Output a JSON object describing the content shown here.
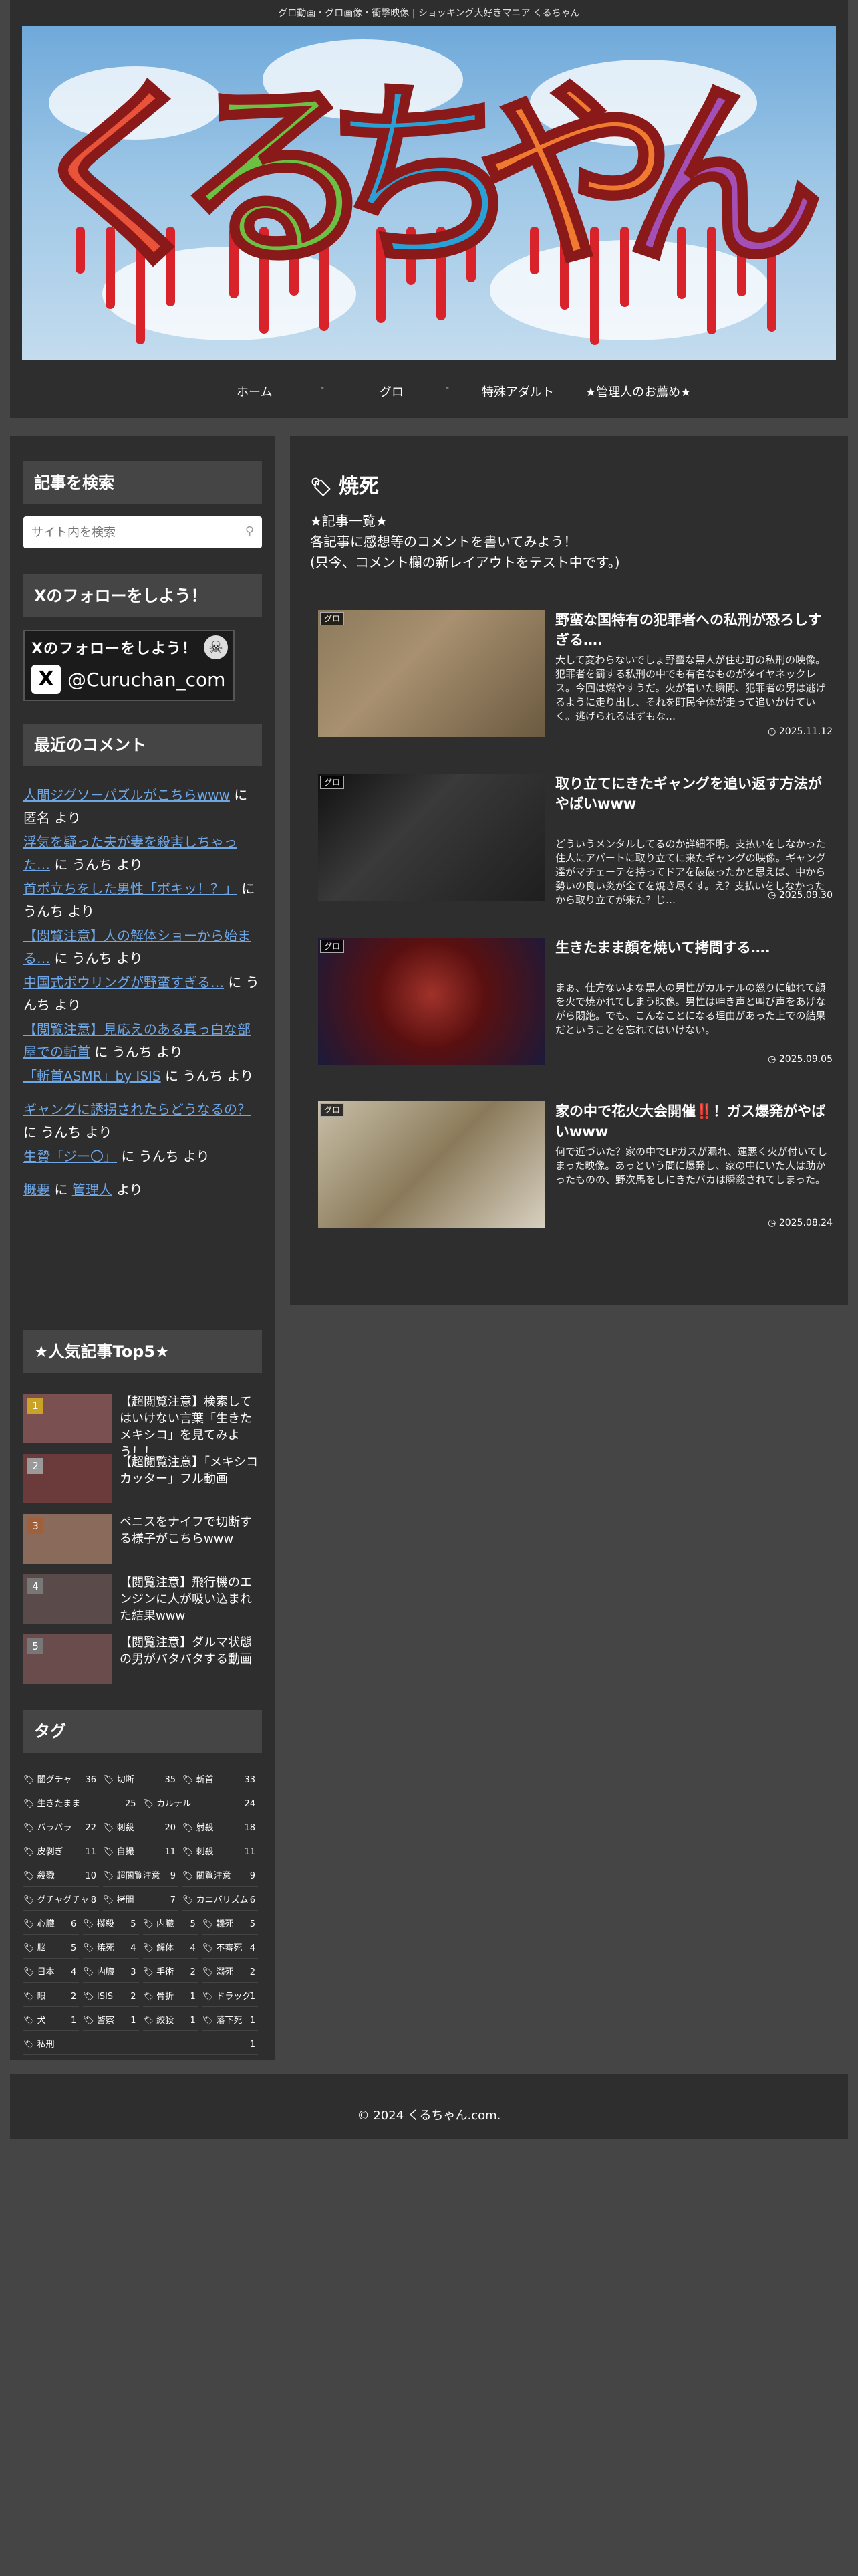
{
  "header": {
    "tagline": "グロ動画・グロ画像・衝撃映像 | ショッキング大好きマニア くるちゃん",
    "banner_chars": [
      "く",
      "る",
      "ち",
      "や",
      "ん"
    ],
    "banner_colors": [
      "#e8533a",
      "#6cc043",
      "#2aa1d6",
      "#f07a2f",
      "#a34fb5"
    ],
    "nav": [
      {
        "label": "ホーム"
      },
      {
        "label": "グロ"
      },
      {
        "label": "特殊アダルト"
      },
      {
        "label": "★管理人のお薦め★"
      }
    ],
    "nav_separator": "-"
  },
  "sidebar": {
    "search": {
      "title": "記事を検索",
      "placeholder": "サイト内を検索"
    },
    "follow": {
      "title": "Xのフォローをしよう！",
      "banner_line1": "Xのフォローをしよう！",
      "handle": "@Curuchan_com"
    },
    "comments": {
      "title": "最近のコメント",
      "items": [
        {
          "link": "人間ジグソーパズルがこちらwww",
          "by": " に 匿名 より"
        },
        {
          "link": "浮気を疑った夫が妻を殺害しちゃった…",
          "by": " に うんち より"
        },
        {
          "link": "首ポ立ちをした男性「ボキッ！？」",
          "by": " に うんち より"
        },
        {
          "link": "【閲覧注意】人の解体ショーから始まる…",
          "by": " に うんち より"
        },
        {
          "link": "中国式ボウリングが野蛮すぎる…",
          "by": " に うんち より"
        },
        {
          "link": "【閲覧注意】見応えのある真っ白な部屋での斬首",
          "by": " に うんち より"
        },
        {
          "link": "「斬首ASMR」by ISIS",
          "by": " に うんち より"
        },
        {
          "link": "ギャングに誘拐されたらどうなるの？",
          "by": " に うんち より"
        },
        {
          "link": "生贄「ジー〇」",
          "by": " に うんち より"
        },
        {
          "link": "概要",
          "by_pre": " に ",
          "by_link": "管理人",
          "by_post": " より"
        }
      ]
    },
    "ranking": {
      "title": "★人気記事Top5★",
      "items": [
        {
          "rank": "1",
          "title": "【超閲覧注意】検索してはいけない言葉「生きたメキシコ」を見てみよう！！",
          "color": "#c9a227"
        },
        {
          "rank": "2",
          "title": "【超閲覧注意】「メキシコカッター」フル動画",
          "color": "#9a9a9a"
        },
        {
          "rank": "3",
          "title": "ペニスをナイフで切断する様子がこちらwww",
          "color": "#a0603a"
        },
        {
          "rank": "4",
          "title": "【閲覧注意】飛行機のエンジンに人が吸い込まれた結果www",
          "color": "#777777"
        },
        {
          "rank": "5",
          "title": "【閲覧注意】ダルマ状態の男がバタバタする動画",
          "color": "#777777"
        }
      ]
    },
    "tags": {
      "title": "タグ",
      "items": [
        [
          "闇グチャ",
          "36"
        ],
        [
          "切断",
          "35"
        ],
        [
          "斬首",
          "33"
        ],
        [
          "生きたまま",
          "25"
        ],
        [
          "カルテル",
          "24"
        ],
        [
          "バラバラ",
          "22"
        ],
        [
          "刺殺",
          "20"
        ],
        [
          "射殺",
          "18"
        ],
        [
          "皮剥ぎ",
          "11"
        ],
        [
          "自撮",
          "11"
        ],
        [
          "刺殺",
          "11"
        ],
        [
          "殺戮",
          "10"
        ],
        [
          "超閲覧注意",
          "9"
        ],
        [
          "閲覧注意",
          "9"
        ],
        [
          "グチャグチャ",
          "8"
        ],
        [
          "拷問",
          "7"
        ],
        [
          "カニバリズム",
          "6"
        ],
        [
          "心臓",
          "6"
        ],
        [
          "撲殺",
          "5"
        ],
        [
          "内臓",
          "5"
        ],
        [
          "轢死",
          "5"
        ],
        [
          "脳",
          "5"
        ],
        [
          "焼死",
          "4"
        ],
        [
          "解体",
          "4"
        ],
        [
          "不審死",
          "4"
        ],
        [
          "日本",
          "4"
        ],
        [
          "内臓",
          "3"
        ],
        [
          "手術",
          "2"
        ],
        [
          "溺死",
          "2"
        ],
        [
          "眼",
          "2"
        ],
        [
          "ISIS",
          "2"
        ],
        [
          "骨折",
          "1"
        ],
        [
          "ドラッグ",
          "1"
        ],
        [
          "犬",
          "1"
        ],
        [
          "警察",
          "1"
        ],
        [
          "絞殺",
          "1"
        ],
        [
          "落下死",
          "1"
        ],
        [
          "私刑",
          "1"
        ]
      ]
    }
  },
  "main": {
    "page_title": "焼死",
    "intro": [
      "★記事一覧★",
      "各記事に感想等のコメントを書いてみよう！",
      "(只今、コメント欄の新レイアウトをテスト中です。)"
    ],
    "cards": [
      {
        "category": "グロ",
        "title": "野蛮な国特有の犯罪者への私刑が恐ろしすぎる….",
        "excerpt": "大して変わらないでしょ野蛮な黒人が住む町の私刑の映像。犯罪者を罰する私刑の中でも有名なものがタイヤネックレス。今回は燃やすうだ。火が着いた瞬間、犯罪者の男は逃げるように走り出し、それを町民全体が走って追いかけていく。逃げられるはずもな…",
        "date": "2025.11.12"
      },
      {
        "category": "グロ",
        "title": "取り立てにきたギャングを追い返す方法がやばいwww",
        "excerpt": "どういうメンタルしてるのか詳細不明。支払いをしなかった住人にアパートに取り立てに来たギャングの映像。ギャング達がマチェーテを持ってドアを破破ったかと思えば、中から勢いの良い炎が全てを焼き尽くす。え？支払いをしなかったから取り立てが来た？じ…",
        "date": "2025.09.30"
      },
      {
        "category": "グロ",
        "title": "生きたまま顔を焼いて拷問する….",
        "excerpt": "まぁ、仕方ないよな黒人の男性がカルテルの怒りに触れて顔を火で焼かれてしまう映像。男性は呻き声と叫び声をあげながら悶絶。でも、こんなことになる理由があった上での結果だということを忘れてはいけない。",
        "date": "2025.09.05"
      },
      {
        "category": "グロ",
        "title": "家の中で花火大会開催‼️！ガス爆発がやばいwww",
        "excerpt": "何で近づいた？家の中でLPガスが漏れ、運悪く火が付いてしまった映像。あっという間に爆発し、家の中にいた人は助かったものの、野次馬をしにきたバカは瞬殺されてしまった。",
        "date": "2025.08.24"
      }
    ]
  },
  "footer": {
    "copyright": "© 2024 くるちゃん.com."
  }
}
